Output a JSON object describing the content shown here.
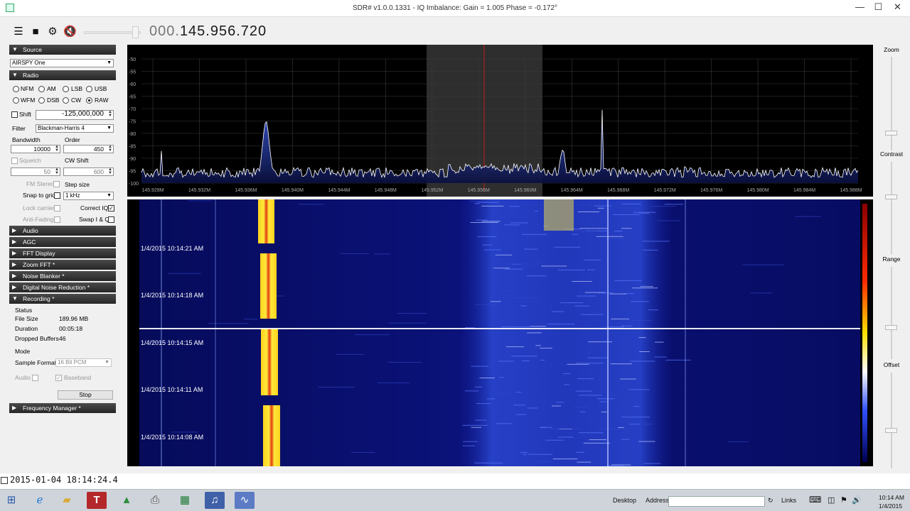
{
  "window": {
    "title": "SDR# v1.0.0.1331 - IQ Imbalance: Gain = 1.005 Phase = -0.172°",
    "minimize": "—",
    "maximize": "☐",
    "close": "✕"
  },
  "toolbar": {
    "menu_icon": "hamburger-icon",
    "stop_icon": "stop-icon",
    "settings_icon": "gear-icon",
    "mute_icon": "speaker-mute-icon",
    "freq_prefix": "000.",
    "freq_main": "145.956.720"
  },
  "source": {
    "header": "Source",
    "device": "AIRSPY One"
  },
  "radio": {
    "header": "Radio",
    "modes": [
      "NFM",
      "AM",
      "LSB",
      "USB",
      "WFM",
      "DSB",
      "CW",
      "RAW"
    ],
    "selected_mode": "RAW",
    "shift_label": "Shift",
    "shift_value": "-125,000,000",
    "filter_label": "Filter",
    "filter_value": "Blackman-Harris 4",
    "bandwidth_label": "Bandwidth",
    "bandwidth_value": "10000",
    "order_label": "Order",
    "order_value": "450",
    "squelch_label": "Squelch",
    "squelch_value": "50",
    "cwshift_label": "CW Shift",
    "cwshift_value": "600",
    "fmstereo_label": "FM Stereo",
    "stepsize_label": "Step size",
    "snap_label": "Snap to grid",
    "stepsize_value": "1 kHz",
    "lockcarrier_label": "Lock carrier",
    "correctiq_label": "Correct IQ",
    "antifading_label": "Anti-Fading",
    "swapiq_label": "Swap I & Q"
  },
  "sections": {
    "audio": "Audio",
    "agc": "AGC",
    "fft": "FFT Display",
    "zoomfft": "Zoom FFT *",
    "noiseblanker": "Noise Blanker *",
    "dnr": "Digital Noise Reduction *",
    "recording": "Recording *",
    "freqmgr": "Frequency Manager *"
  },
  "recording": {
    "status_label": "Status",
    "filesize_label": "File Size",
    "filesize_value": "189.96 MB",
    "duration_label": "Duration",
    "duration_value": "00:05:18",
    "dropped_label": "Dropped Buffers",
    "dropped_value": "46",
    "mode_label": "Mode",
    "format_label": "Sample Format",
    "format_value": "16 Bit PCM",
    "audio_label": "Audio",
    "baseband_label": "Baseband",
    "stop_label": "Stop"
  },
  "spectrum": {
    "y_ticks": [
      "-50",
      "-55",
      "-60",
      "-65",
      "-70",
      "-75",
      "-80",
      "-85",
      "-90",
      "-95",
      "-100"
    ],
    "x_ticks": [
      "145.928M",
      "145.932M",
      "145.936M",
      "145.940M",
      "145.944M",
      "145.948M",
      "145.952M",
      "145.956M",
      "145.960M",
      "145.964M",
      "145.968M",
      "145.972M",
      "145.976M",
      "145.980M",
      "145.984M",
      "145.988M"
    ]
  },
  "waterfall": {
    "timestamps": [
      "1/4/2015 10:14:21 AM",
      "1/4/2015 10:14:18 AM",
      "1/4/2015 10:14:15 AM",
      "1/4/2015 10:14:11 AM",
      "1/4/2015 10:14:08 AM"
    ]
  },
  "right": {
    "zoom_label": "Zoom",
    "contrast_label": "Contrast",
    "range_label": "Range",
    "offset_label": "Offset"
  },
  "status": {
    "datetime": "2015-01-04 18:14:24.4"
  },
  "taskbar": {
    "desktop_label": "Desktop",
    "address_label": "Address",
    "links_label": "Links",
    "time": "10:14 AM",
    "date": "1/4/2015",
    "apps": [
      "start-icon",
      "internet-explorer-icon",
      "file-explorer-icon",
      "text-app-icon",
      "drive-icon",
      "print-icon",
      "spreadsheet-icon",
      "audio-app-icon",
      "sdr-app-icon"
    ]
  },
  "colors": {
    "accent_header": "#262626",
    "waterfall_bg": "#0a0f6e",
    "spectrum_fill": "#1f3aa8"
  }
}
